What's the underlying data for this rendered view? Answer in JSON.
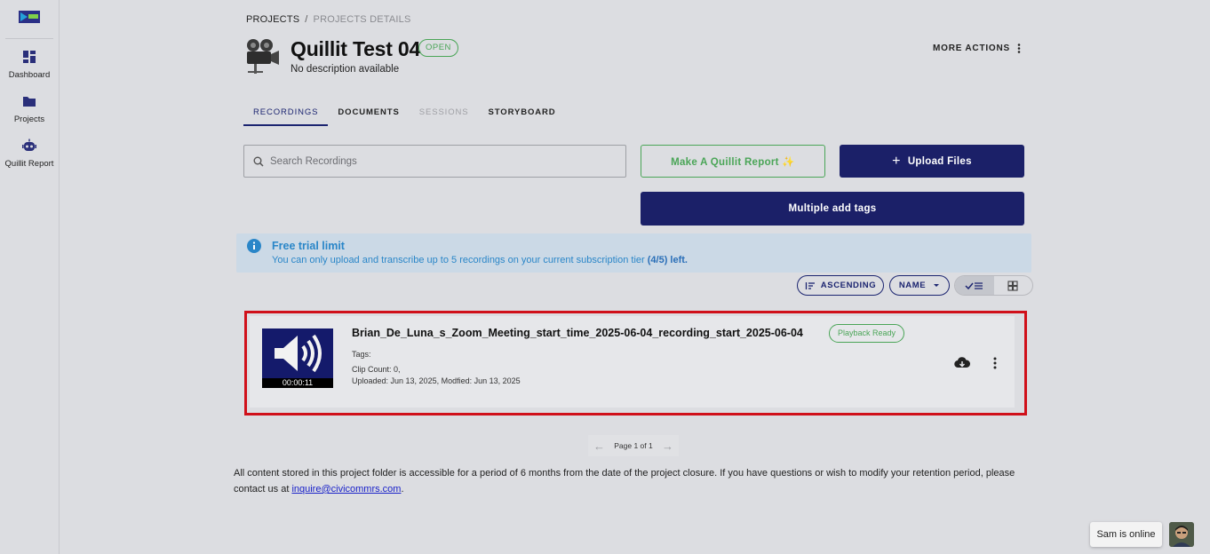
{
  "sidebar": {
    "logo_alt": "Quillit logo",
    "items": [
      {
        "label": "Dashboard",
        "icon": "dashboard-icon"
      },
      {
        "label": "Projects",
        "icon": "folder-icon"
      },
      {
        "label": "Quillit Report",
        "icon": "robot-icon"
      }
    ]
  },
  "breadcrumb": {
    "root": "PROJECTS",
    "separator": "/",
    "current": "PROJECTS DETAILS"
  },
  "project": {
    "title": "Quillit Test 04",
    "status": "OPEN",
    "description": "No description available",
    "icon": "movie-camera-icon"
  },
  "header": {
    "more_actions": "MORE ACTIONS"
  },
  "tabs": [
    {
      "label": "RECORDINGS",
      "state": "active"
    },
    {
      "label": "DOCUMENTS",
      "state": "normal"
    },
    {
      "label": "SESSIONS",
      "state": "disabled"
    },
    {
      "label": "STORYBOARD",
      "state": "normal"
    }
  ],
  "search": {
    "placeholder": "Search Recordings",
    "value": ""
  },
  "actions": {
    "quillit_report": "Make A Quillit Report ✨",
    "upload": "Upload Files",
    "multiple_tags": "Multiple add tags"
  },
  "alert": {
    "title": "Free trial limit",
    "text": "You can only upload and transcribe up to 5 recordings on your current subscription tier",
    "count": "(4/5) left."
  },
  "sort": {
    "order": "ASCENDING",
    "field": "NAME"
  },
  "recordings": [
    {
      "title": "Brian_De_Luna_s_Zoom_Meeting_start_time_2025-06-04_recording_start_2025-06-04",
      "status": "Playback Ready",
      "duration": "00:00:11",
      "tags": "Tags:",
      "clip_count": "Clip Count: 0,",
      "dates": "Uploaded: Jun 13, 2025, Modfied: Jun 13, 2025"
    }
  ],
  "pagination": {
    "label": "Page 1 of 1"
  },
  "retention": {
    "text": "All content stored in this project folder is accessible for a period of 6 months from the date of the project closure. If you have questions or wish to modify your retention period, please contact us at ",
    "email": "inquire@civicommrs.com",
    "end": "."
  },
  "chat": {
    "status": "Sam is online"
  },
  "colors": {
    "primary": "#1b2068",
    "accent_green": "#4aa557",
    "info_blue": "#2a86c8",
    "highlight_red": "#d0101a"
  }
}
